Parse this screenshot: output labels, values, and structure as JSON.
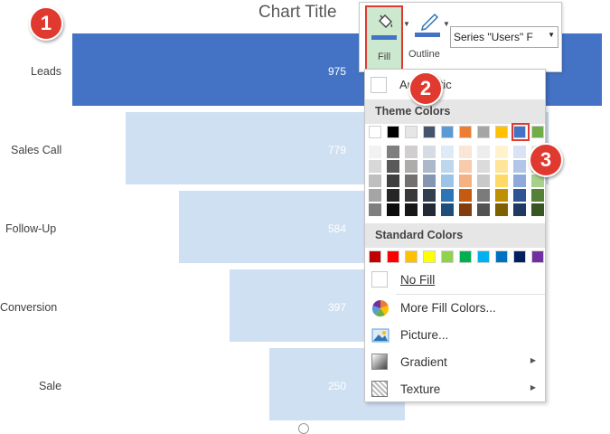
{
  "chart": {
    "title": "Chart Title",
    "colors": {
      "highlight": "#4472c4",
      "light": "#cfe0f2"
    }
  },
  "chart_data": {
    "type": "bar",
    "title": "Chart Title",
    "categories": [
      "Leads",
      "Sales Call",
      "Follow-Up",
      "Conversion",
      "Sale"
    ],
    "values": [
      975,
      779,
      584,
      397,
      250
    ],
    "series": [
      {
        "name": "Users",
        "values": [
          975,
          779,
          584,
          397,
          250
        ]
      }
    ],
    "orientation": "horizontal-funnel",
    "highlighted_category": "Leads"
  },
  "annotations": {
    "step1": "1",
    "step2": "2",
    "step3": "3"
  },
  "toolbar": {
    "fill_label": "Fill",
    "outline_label": "Outline",
    "series_select_value": "Series \"Users\" F",
    "icons": {
      "fill": "paint-bucket-icon",
      "outline": "pen-icon",
      "dropdown": "chevron-down-icon"
    }
  },
  "fill_menu": {
    "automatic_label": "Automatic",
    "theme_colors_label": "Theme Colors",
    "standard_colors_label": "Standard Colors",
    "no_fill_label": "No Fill",
    "more_colors_label": "More Fill Colors...",
    "picture_label": "Picture...",
    "gradient_label": "Gradient",
    "texture_label": "Texture",
    "theme_colors": [
      "#ffffff",
      "#000000",
      "#e7e6e6",
      "#44546a",
      "#5b9bd5",
      "#ed7d31",
      "#a5a5a5",
      "#ffc000",
      "#4472c4",
      "#70ad47"
    ],
    "theme_tints": [
      [
        "#f2f2f2",
        "#7f7f7f",
        "#d0cece",
        "#d6dce4",
        "#deebf6",
        "#fbe5d5",
        "#ededed",
        "#fff2cc",
        "#dae3f3",
        "#e2efd9"
      ],
      [
        "#d8d8d8",
        "#595959",
        "#aeabab",
        "#adb9ca",
        "#bdd7ee",
        "#f7cbac",
        "#dbdbdb",
        "#fee599",
        "#b4c6e7",
        "#c5e0b3"
      ],
      [
        "#bfbfbf",
        "#3f3f3f",
        "#757070",
        "#8496b0",
        "#9dc3e6",
        "#f4b183",
        "#c9c9c9",
        "#ffd965",
        "#8eaadb",
        "#a8d08d"
      ],
      [
        "#a5a5a5",
        "#262626",
        "#3a3838",
        "#323f4f",
        "#2e75b5",
        "#c55a11",
        "#7b7b7b",
        "#bf9000",
        "#2f5496",
        "#538135"
      ],
      [
        "#7f7f7f",
        "#0c0c0c",
        "#171616",
        "#222a35",
        "#1e4e79",
        "#833c0b",
        "#525252",
        "#7f6000",
        "#1f3864",
        "#375623"
      ]
    ],
    "standard_colors": [
      "#c00000",
      "#ff0000",
      "#ffc000",
      "#ffff00",
      "#92d050",
      "#00b050",
      "#00b0f0",
      "#0070c0",
      "#002060",
      "#7030a0"
    ],
    "icons": {
      "more_colors": "color-wheel-icon",
      "picture": "picture-icon",
      "gradient": "gradient-icon",
      "texture": "texture-icon",
      "submenu": "chevron-right-icon"
    }
  }
}
